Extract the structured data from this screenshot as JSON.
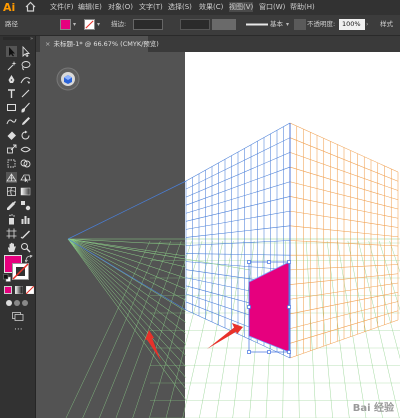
{
  "app": {
    "logo": "Ai"
  },
  "menu": [
    "文件(F)",
    "编辑(E)",
    "对象(O)",
    "文字(T)",
    "选择(S)",
    "效果(C)",
    "视图(V)",
    "窗口(W)",
    "帮助(H)"
  ],
  "control": {
    "object_label": "路径",
    "stroke_label": "描边:",
    "stroke_style": "基本",
    "opacity_label": "不透明度:",
    "opacity_value": "100%",
    "style_label": "样式"
  },
  "document": {
    "tab_title": "未标题-1* @ 66.67% (CMYK/预览)",
    "close": "×"
  },
  "colors": {
    "fill": "#e6007e",
    "accent": "#ff9a00",
    "grid_blue": "#4a7fd8",
    "grid_orange": "#f0a050",
    "grid_green": "#8ccf88",
    "arrow": "#e8322a"
  },
  "icons": [
    "home-icon",
    "selection-tool-icon",
    "direct-selection-tool-icon",
    "magic-wand-icon",
    "lasso-icon",
    "pen-tool-icon",
    "curvature-icon",
    "type-tool-icon",
    "line-tool-icon",
    "rectangle-tool-icon",
    "paintbrush-icon",
    "shaper-icon",
    "pencil-icon",
    "eraser-icon",
    "rotate-icon",
    "scale-icon",
    "width-tool-icon",
    "free-transform-icon",
    "shape-builder-icon",
    "perspective-grid-icon",
    "perspective-selection-icon",
    "mesh-icon",
    "gradient-icon",
    "eyedropper-icon",
    "blend-icon",
    "symbol-sprayer-icon",
    "graph-icon",
    "artboard-icon",
    "slice-icon",
    "hand-icon",
    "zoom-icon",
    "fill-swatch-icon",
    "stroke-swatch-icon",
    "swap-colors-icon",
    "default-colors-icon",
    "color-mode-icon",
    "gradient-mode-icon",
    "none-mode-icon",
    "draw-mode-icon",
    "screen-mode-icon",
    "more-tools-icon",
    "plane-switching-widget-icon",
    "red-arrow-icon"
  ],
  "watermark": "Bai 经验"
}
